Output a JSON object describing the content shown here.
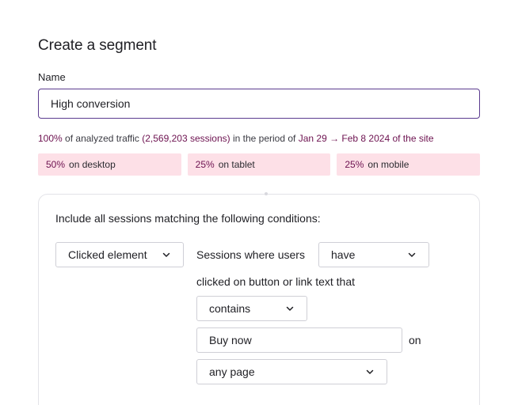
{
  "page": {
    "title": "Create a segment"
  },
  "name_field": {
    "label": "Name",
    "value": "High conversion"
  },
  "traffic_summary": {
    "percent": "100%",
    "text1": "of analyzed traffic",
    "sessions": "(2,569,203 sessions)",
    "text2": "in the period of",
    "period": "Jan 29 → Feb 8 2024 of the site"
  },
  "devices": [
    {
      "percent": "50%",
      "label": "on desktop"
    },
    {
      "percent": "25%",
      "label": "on tablet"
    },
    {
      "percent": "25%",
      "label": "on mobile"
    }
  ],
  "conditions": {
    "heading": "Include all sessions matching the following conditions:",
    "event_select": "Clicked element",
    "sessions_text": "Sessions where users",
    "have_select": "have",
    "clicked_text": "clicked on button or link text that",
    "match_select": "contains",
    "value_input": "Buy now",
    "on_text": "on",
    "page_select": "any page"
  },
  "icons": {
    "dropdown": "chevron-down-icon"
  },
  "colors": {
    "accent": "#6d1250",
    "device_bg": "#fde0e7",
    "input_focus_border": "#5b3b8f"
  }
}
